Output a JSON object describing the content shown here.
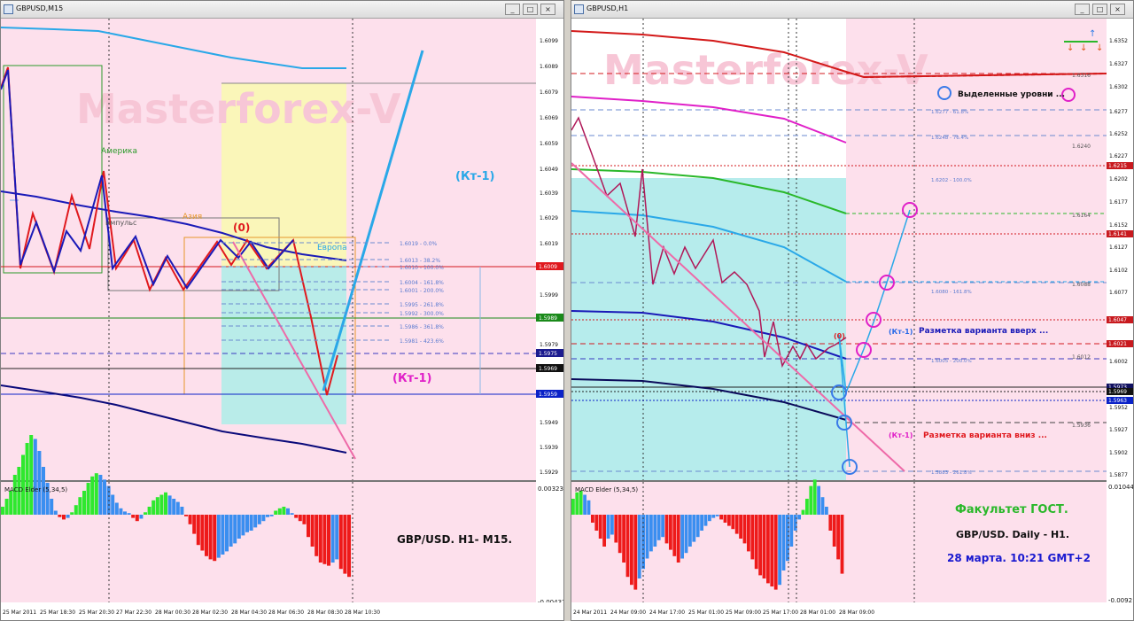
{
  "left": {
    "title": "GBPUSD,M15",
    "watermark": "Masterforex-V",
    "labels": {
      "america": "Америка",
      "asia": "Азия",
      "europe": "Европа",
      "impulse": "импульс",
      "zero": "(0)",
      "kt1_up": "(Кт-1)",
      "kt1_down": "(Кт-1)",
      "caption": "GBP/USD.  H1- M15."
    },
    "fib_labels": [
      "1.6019 - 0.0%",
      "1.6013 - 38.2%",
      "1.6010 - 100.0%",
      "1.6004 - 161.8%",
      "1.6001 - 200.0%",
      "1.5995 - 261.8%",
      "1.5992 - 300.0%",
      "1.5986 - 361.8%",
      "1.5981 - 423.6%"
    ],
    "price_ticks": [
      "1.6099",
      "1.6089",
      "1.6079",
      "1.6069",
      "1.6059",
      "1.6049",
      "1.6039",
      "1.6029",
      "1.6019",
      "1.5999",
      "1.5979",
      "1.5949",
      "1.5939",
      "1.5929"
    ],
    "price_tags": [
      {
        "text": "1.6009",
        "color": "#e0191e"
      },
      {
        "text": "1.5989",
        "color": "#1a8a1a"
      },
      {
        "text": "1.5975",
        "color": "#1b1b8f"
      },
      {
        "text": "1.5969",
        "color": "#111111"
      },
      {
        "text": "1.5959",
        "color": "#0a22c8"
      }
    ],
    "macd_title": "MACD Elder (5,34,5)",
    "macd_ticks": [
      "0.00323",
      "-0.00431"
    ],
    "time_ticks": [
      "25 Mar 2011",
      "25 Mar 18:30",
      "25 Mar 20:30",
      "27 Mar 22:30",
      "28 Mar 00:30",
      "28 Mar 02:30",
      "28 Mar 04:30",
      "28 Mar 06:30",
      "28 Mar 08:30",
      "28 Mar 10:30"
    ]
  },
  "right": {
    "title": "GBPUSD,H1",
    "watermark": "Masterforex-V",
    "labels": {
      "legend": "Выделенные уровни ...",
      "zero": "(0)",
      "kt1_up": "(Кт-1)",
      "up_text": "Разметка варианта вверх ...",
      "kt1_down": "(Кт-1)",
      "down_text": "Разметка варианта вниз ...",
      "faculty": "Факультет ГОСТ.",
      "caption": "GBP/USD. Daily - H1.",
      "date": "28 марта. 10:21 GMT+2"
    },
    "fib_labels": [
      "1.6277 - 61.8%",
      "1.6248 - 76.4%",
      "1.6202 - 100.0%",
      "1.6080 - 161.8%",
      "1.6005 - 200.0%",
      "1.5883 - 261.8%"
    ],
    "level_labels": [
      "1.6316",
      "1.6240",
      "1.6164",
      "1.6088",
      "1.6012",
      "1.5936"
    ],
    "price_ticks": [
      "1.6352",
      "1.6327",
      "1.6302",
      "1.6277",
      "1.6252",
      "1.6227",
      "1.6202",
      "1.6177",
      "1.6152",
      "1.6127",
      "1.6102",
      "1.6077",
      "1.6002",
      "1.5952",
      "1.5927",
      "1.5902",
      "1.5877"
    ],
    "price_tags": [
      {
        "text": "1.6215",
        "color": "#c8191e"
      },
      {
        "text": "1.6141",
        "color": "#c8191e"
      },
      {
        "text": "1.6047",
        "color": "#c8191e"
      },
      {
        "text": "1.6021",
        "color": "#c8191e"
      },
      {
        "text": "1.5973",
        "color": "#101060"
      },
      {
        "text": "1.5969",
        "color": "#111111"
      },
      {
        "text": "1.5963",
        "color": "#0a22c8"
      }
    ],
    "macd_title": "MACD Elder (5,34,5)",
    "macd_ticks": [
      "0.01044",
      "-0.0092"
    ],
    "time_ticks": [
      "24 Mar 2011",
      "24 Mar 09:00",
      "24 Mar 17:00",
      "25 Mar 01:00",
      "25 Mar 09:00",
      "25 Mar 17:00",
      "28 Mar 01:00",
      "28 Mar 09:00"
    ]
  }
}
